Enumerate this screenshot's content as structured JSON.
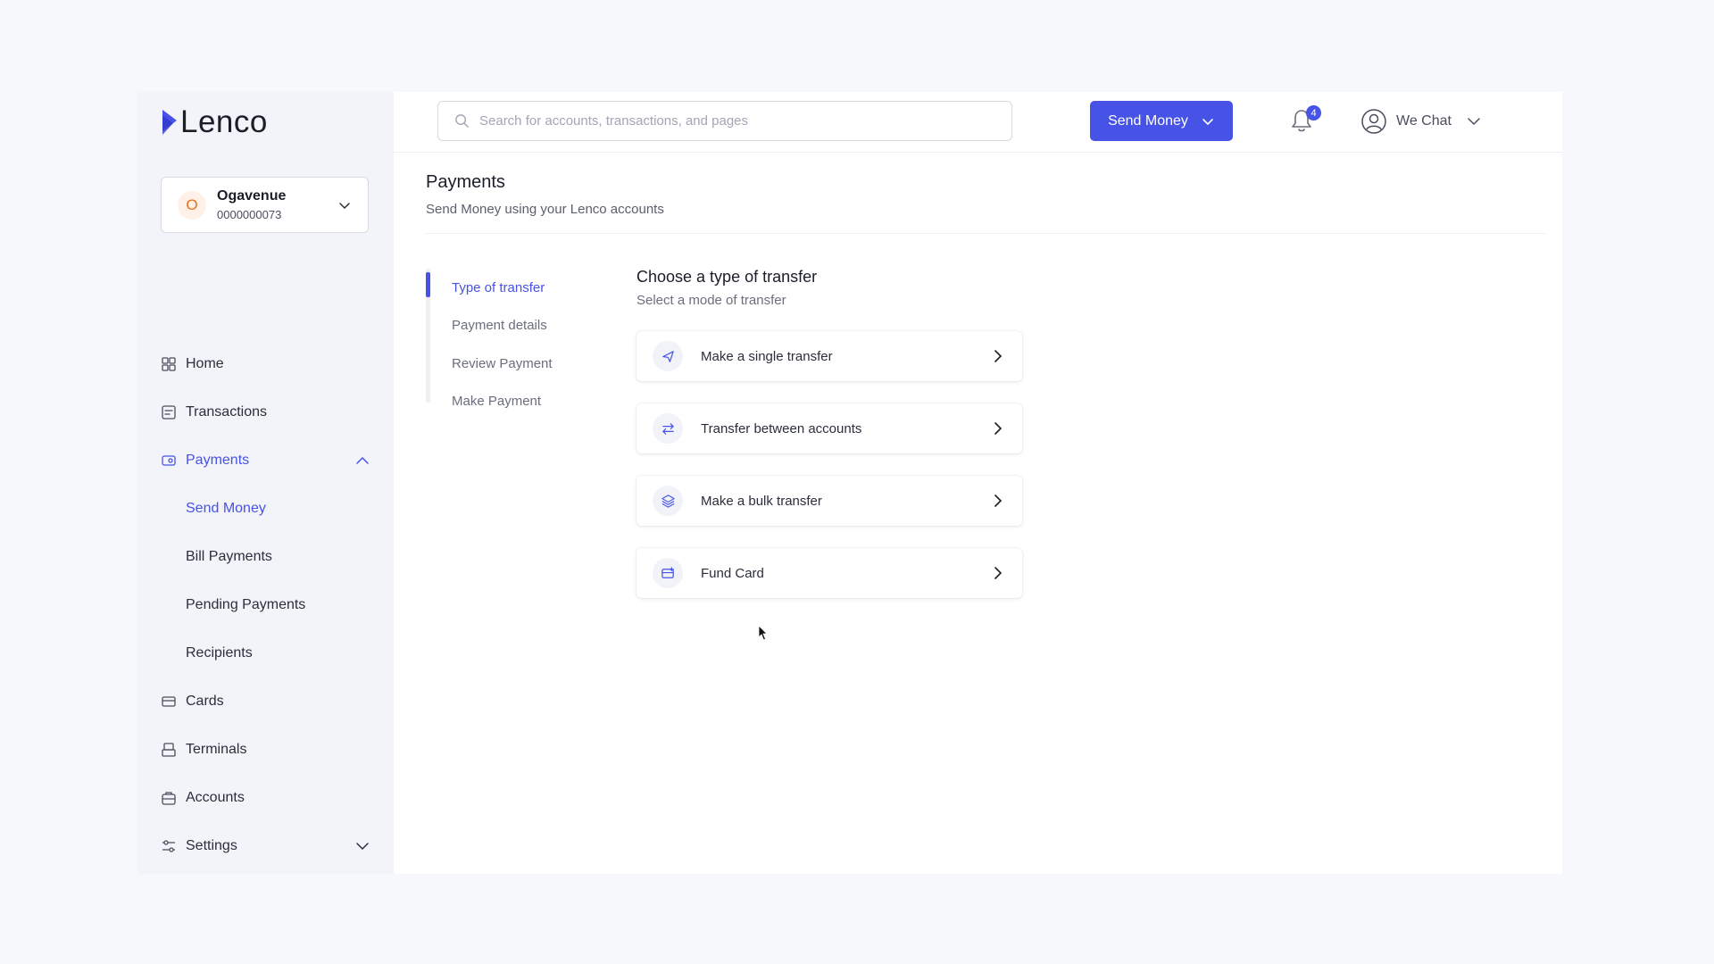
{
  "brand": {
    "name": "Lenco"
  },
  "account": {
    "initial": "O",
    "name": "Ogavenue",
    "number": "0000000073"
  },
  "sidebar": {
    "items": [
      {
        "label": "Home",
        "icon": "home-grid-icon"
      },
      {
        "label": "Transactions",
        "icon": "transactions-icon"
      },
      {
        "label": "Payments",
        "icon": "payments-icon",
        "expanded": true,
        "children": [
          {
            "label": "Send Money",
            "active": true
          },
          {
            "label": "Bill Payments"
          },
          {
            "label": "Pending Payments"
          },
          {
            "label": "Recipients"
          }
        ]
      },
      {
        "label": "Cards",
        "icon": "card-icon"
      },
      {
        "label": "Terminals",
        "icon": "terminal-icon"
      },
      {
        "label": "Accounts",
        "icon": "briefcase-icon"
      },
      {
        "label": "Settings",
        "icon": "sliders-icon",
        "expanded": false
      }
    ]
  },
  "topbar": {
    "search_placeholder": "Search for accounts, transactions, and pages",
    "send_money_label": "Send Money",
    "notifications_count": "4",
    "user_label": "We Chat",
    "flag": "nigeria-flag"
  },
  "page": {
    "title": "Payments",
    "subtitle": "Send Money using your Lenco accounts"
  },
  "stepper": {
    "steps": [
      "Type of transfer",
      "Payment details",
      "Review Payment",
      "Make Payment"
    ],
    "active_index": 0
  },
  "transfer": {
    "title": "Choose a type of transfer",
    "subtitle": "Select a mode of transfer",
    "options": [
      {
        "label": "Make a single transfer",
        "icon": "send-icon"
      },
      {
        "label": "Transfer between accounts",
        "icon": "swap-arrows-icon"
      },
      {
        "label": "Make a bulk transfer",
        "icon": "layers-icon"
      },
      {
        "label": "Fund Card",
        "icon": "card-fund-icon"
      }
    ]
  },
  "colors": {
    "accent": "#4752e6",
    "sidebar_bg": "#f3f4f9",
    "page_bg": "#f7f8fc"
  }
}
